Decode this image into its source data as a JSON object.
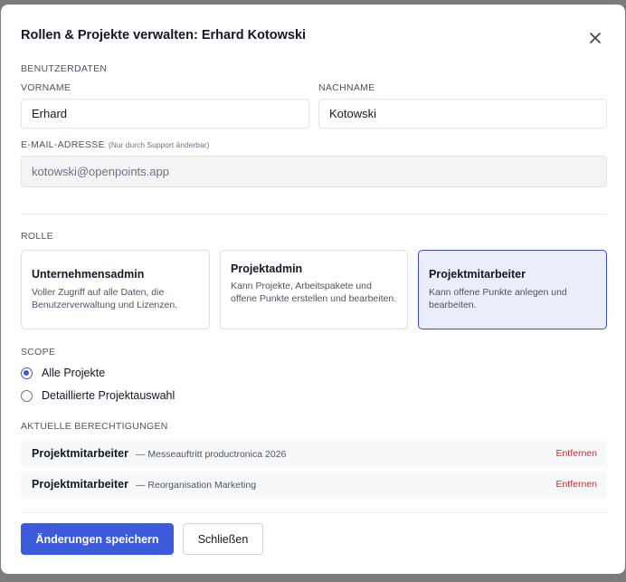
{
  "dialog": {
    "title": "Rollen & Projekte verwalten: Erhard Kotowski"
  },
  "icons": {
    "close": "close-icon"
  },
  "colors": {
    "primary": "#3b5bdb",
    "danger": "#dc2626",
    "selected_bg": "#eaeefa"
  },
  "user_data": {
    "section_label": "BENUTZERDATEN",
    "first_name_label": "VORNAME",
    "first_name_value": "Erhard",
    "last_name_label": "NACHNAME",
    "last_name_value": "Kotowski",
    "email_label": "E-MAIL-ADRESSE",
    "email_hint": "(Nur durch Support änderbar)",
    "email_value": "kotowski@openpoints.app"
  },
  "role": {
    "section_label": "ROLLE",
    "options": [
      {
        "name": "Unternehmensadmin",
        "description": "Voller Zugriff auf alle Daten, die Benutzerverwaltung und Lizenzen.",
        "selected": false
      },
      {
        "name": "Projektadmin",
        "description": "Kann Projekte, Arbeitspakete und offene Punkte erstellen und bearbeiten.",
        "selected": false
      },
      {
        "name": "Projektmitarbeiter",
        "description": "Kann offene Punkte anlegen und bearbeiten.",
        "selected": true
      }
    ]
  },
  "scope": {
    "section_label": "SCOPE",
    "options": [
      {
        "label": "Alle Projekte",
        "checked": true
      },
      {
        "label": "Detaillierte Projektauswahl",
        "checked": false
      }
    ]
  },
  "permissions": {
    "section_label": "AKTUELLE BERECHTIGUNGEN",
    "items": [
      {
        "role": "Projektmitarbeiter",
        "project": "— Messeauftritt productronica 2026",
        "remove_label": "Entfernen"
      },
      {
        "role": "Projektmitarbeiter",
        "project": "— Reorganisation Marketing",
        "remove_label": "Entfernen"
      }
    ]
  },
  "footer": {
    "save_label": "Änderungen speichern",
    "close_label": "Schließen"
  }
}
